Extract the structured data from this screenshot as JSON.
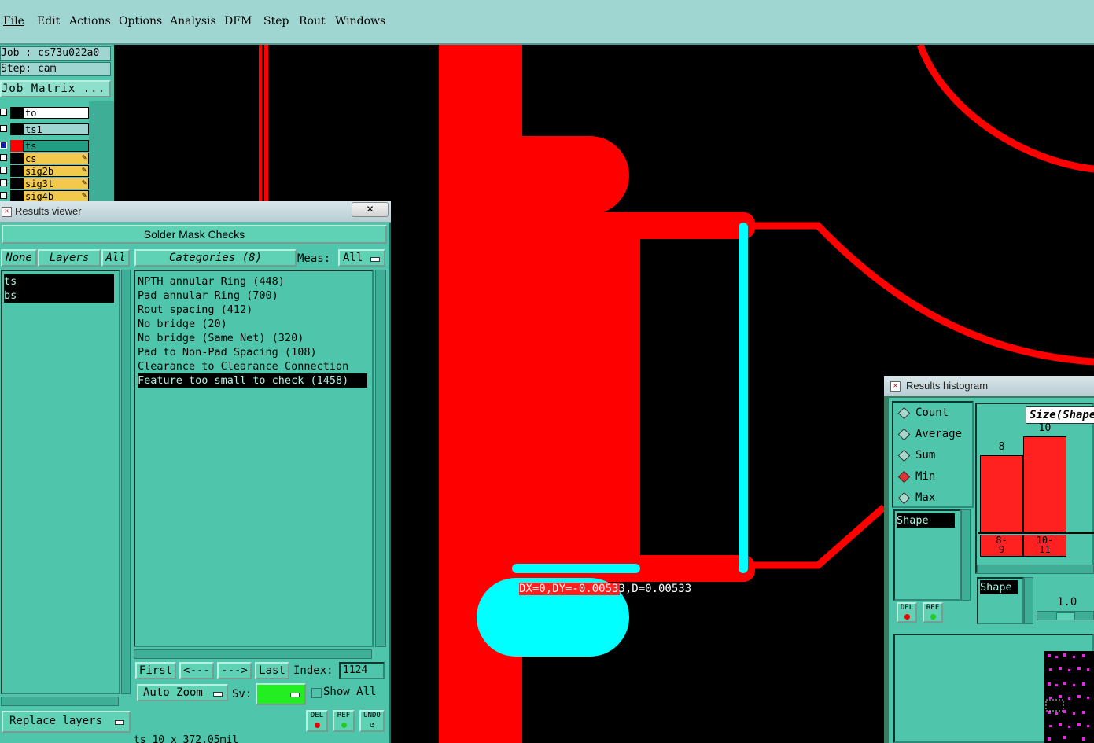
{
  "menubar": {
    "items": [
      "File",
      "Edit",
      "Actions",
      "Options",
      "Analysis",
      "DFM",
      "Step",
      "Rout",
      "Windows"
    ]
  },
  "job_panel": {
    "job_text": "Job : cs73u022a0",
    "step_text": "Step: cam",
    "job_matrix_label": "Job Matrix ...",
    "layers": [
      {
        "name": "to"
      },
      {
        "name": "ts1"
      },
      {
        "name": "ts"
      },
      {
        "name": "cs"
      },
      {
        "name": "sig2b"
      },
      {
        "name": "sig3t"
      },
      {
        "name": "sig4b"
      }
    ]
  },
  "results_viewer": {
    "window_title": "Results viewer",
    "close_glyph": "✕",
    "header": "Solder Mask Checks",
    "none_label": "None",
    "layers_label": "Layers",
    "all_label": "All",
    "categories_label": "Categories (8)",
    "meas_label": "Meas:",
    "meas_value": "All",
    "layer_list": [
      "ts",
      "bs"
    ],
    "categories": [
      "NPTH annular Ring (448)",
      "Pad annular Ring (700)",
      "Rout spacing (412)",
      "No bridge (20)",
      "No bridge (Same Net) (320)",
      "Pad to Non-Pad Spacing (108)",
      "Clearance to Clearance Connection",
      "Feature too small to check (1458)"
    ],
    "first_label": "First",
    "prev_label": "<---",
    "next_label": "--->",
    "last_label": "Last",
    "index_label": "Index:",
    "index_value": "1124",
    "auto_zoom_label": "Auto Zoom",
    "sv_label": "Sv:",
    "show_all_label": "Show All",
    "replace_layers_label": "Replace layers",
    "del_label": "DEL",
    "ref_label": "REF",
    "undo_label": "UNDO",
    "status_text": "ts 10 x 372.05mil"
  },
  "canvas": {
    "measure_text": "DX=0,DY=-0.00533,D=0.00533"
  },
  "histogram": {
    "window_title": "Results histogram",
    "modes": [
      "Count",
      "Average",
      "Sum",
      "Min",
      "Max"
    ],
    "selected_mode": "Min",
    "axis_title": "Size(Shape",
    "shape_list_item": "Shape",
    "shape_label": "Shape",
    "scale_value": "1.0",
    "del_label": "DEL",
    "ref_label": "REF",
    "bars": [
      {
        "label_top": "8-",
        "label_bottom": "9",
        "value": 8
      },
      {
        "label_top": "10-",
        "label_bottom": "11",
        "value": 10
      }
    ]
  },
  "colors": {
    "red": "#ff0000",
    "cyan": "#00ffff",
    "panel": "#4fc6ab",
    "menubar": "#a0d6d2",
    "sv_swatch": "#22ee22"
  }
}
